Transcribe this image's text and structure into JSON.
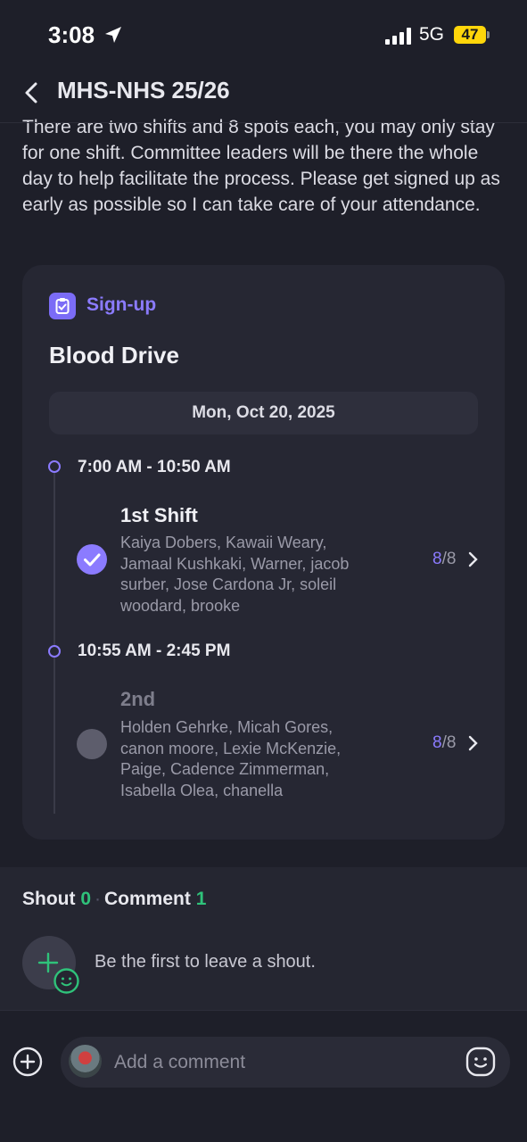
{
  "status_bar": {
    "time": "3:08",
    "network": "5G",
    "battery": "47"
  },
  "nav": {
    "title": "MHS-NHS 25/26"
  },
  "post": {
    "body": "There are two shifts and 8 spots each, you may only stay for one shift. Committee leaders will be there the whole day to help facilitate the process. Please get signed up as early as possible so I can take care of your attendance."
  },
  "signup": {
    "label": "Sign-up",
    "title": "Blood Drive",
    "date": "Mon, Oct 20, 2025",
    "shifts": [
      {
        "time": "7:00 AM - 10:50 AM",
        "name": "1st Shift",
        "names_lines": [
          "Kaiya Dobers, Kawaii Weary,",
          "Jamaal Kushkaki, Warner, jacob",
          "surber, Jose Cardona Jr, soleil",
          "woodard, brooke"
        ],
        "filled": "8",
        "total": "/8",
        "selected": true
      },
      {
        "time": "10:55 AM - 2:45 PM",
        "name": "2nd",
        "names_lines": [
          "Holden Gehrke, Micah Gores,",
          "canon moore, Lexie McKenzie,",
          "Paige, Cadence Zimmerman,",
          "Isabella Olea, chanella"
        ],
        "filled": "8",
        "total": "/8",
        "selected": false
      }
    ]
  },
  "engagement": {
    "shout_label": "Shout",
    "shout_count": "0",
    "comment_label": "Comment",
    "comment_count": "1",
    "empty_shout": "Be the first to leave a shout."
  },
  "composer": {
    "placeholder": "Add a comment"
  },
  "colors": {
    "accent": "#8b7bff",
    "count_green": "#2fc27a",
    "background": "#1e1f29"
  }
}
